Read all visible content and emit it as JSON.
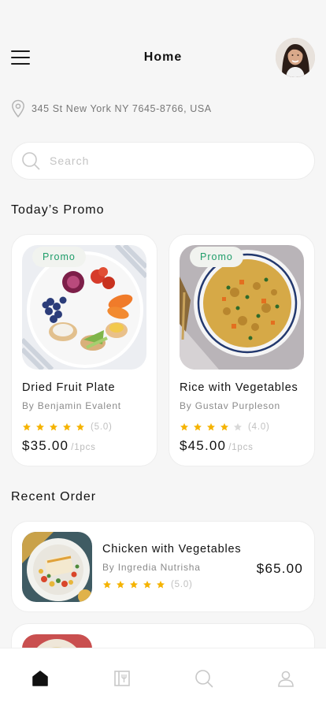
{
  "header": {
    "title": "Home",
    "menu_icon": "hamburger-menu-icon",
    "avatar": "user-avatar"
  },
  "location": {
    "icon": "map-pin-icon",
    "address": "345 St New York NY 7645-8766, USA"
  },
  "search": {
    "icon": "search-icon",
    "placeholder": "Search",
    "value": ""
  },
  "promo": {
    "section_title": "Today’s Promo",
    "items": [
      {
        "badge": "Promo",
        "name": "Dried Fruit Plate",
        "by": "By Benjamin Evalent",
        "rating": 5,
        "rating_text": "(5.0)",
        "price": "$35.00",
        "unit": "/1pcs"
      },
      {
        "badge": "Promo",
        "name": "Rice with Vegetables",
        "by": "By Gustav Purpleson",
        "rating": 4,
        "rating_text": "(4.0)",
        "price": "$45.00",
        "unit": "/1pcs"
      }
    ]
  },
  "recent": {
    "section_title": "Recent Order",
    "items": [
      {
        "name": "Chicken with Vegetables",
        "by": "By Ingredia Nutrisha",
        "rating": 5,
        "rating_text": "(5.0)",
        "price": "$65.00"
      }
    ]
  },
  "nav": {
    "items": [
      "home-icon",
      "menu-book-icon",
      "search-icon",
      "profile-icon"
    ],
    "active": "home-icon"
  },
  "colors": {
    "accent_green": "#1f9d6a",
    "star_filled": "#f5b301",
    "star_empty": "#d8d8d8",
    "nav_inactive": "#c8c8c8",
    "nav_active": "#111111"
  }
}
